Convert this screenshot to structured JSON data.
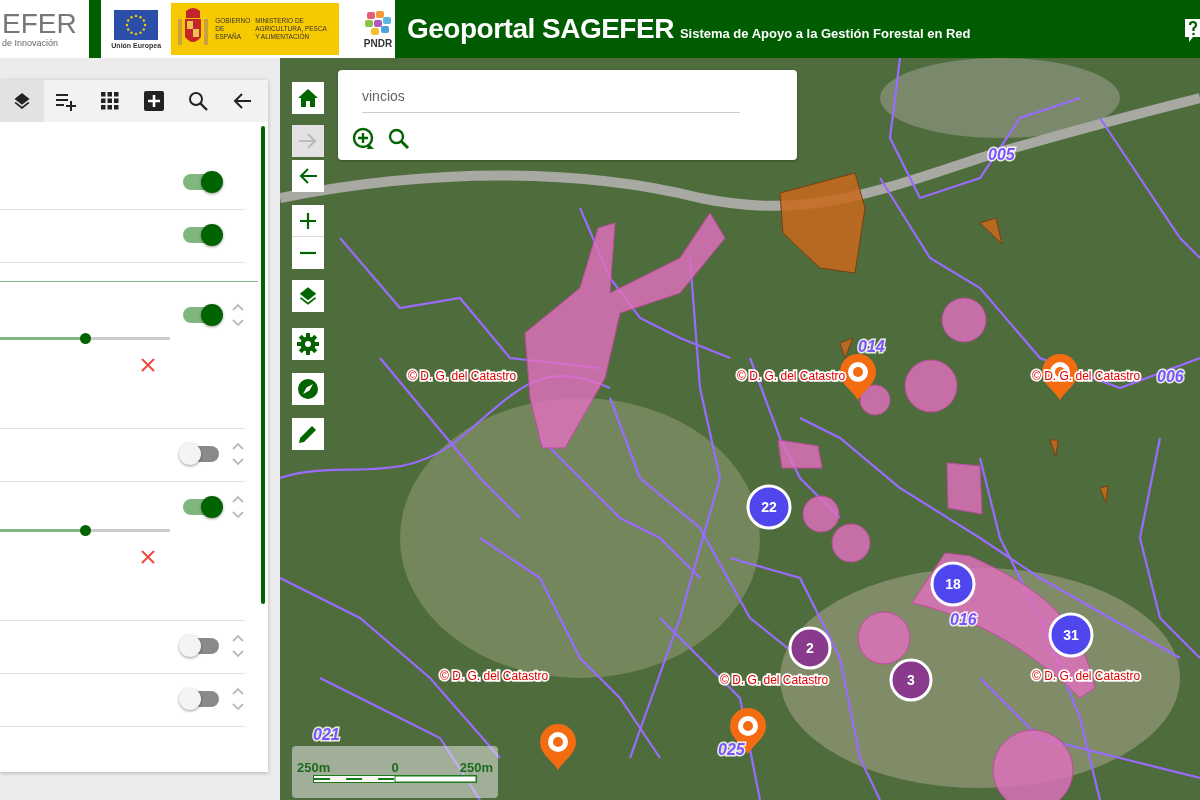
{
  "header": {
    "logo_text": "EFER",
    "logo_subtext": "de Innovación",
    "eu_label": "Unión Europea",
    "gov_label": "GOBIERNO DE ESPAÑA",
    "ministry_label": "MINISTERIO DE AGRICULTURA, PESCA Y ALIMENTACIÓN",
    "pndr_label": "PNDR",
    "title": "Geoportal SAGEFER",
    "subtitle": "Sistema de Apoyo a la Gestión Forestal en Red"
  },
  "panel_tools": [
    {
      "kind": "layers",
      "selected": true
    },
    {
      "kind": "add-list",
      "selected": false
    },
    {
      "kind": "grid",
      "selected": false
    },
    {
      "kind": "plus-box",
      "selected": false
    },
    {
      "kind": "search",
      "selected": false
    },
    {
      "kind": "back",
      "selected": false
    }
  ],
  "layers": [
    {
      "kind": "basic",
      "on": true,
      "order_arrows": false
    },
    {
      "kind": "basic",
      "on": true,
      "order_arrows": false
    },
    {
      "kind": "opacity",
      "on": true,
      "order_arrows": true,
      "level": 0.5
    },
    {
      "kind": "basic",
      "on": false,
      "order_arrows": true
    },
    {
      "kind": "opacity",
      "on": true,
      "order_arrows": true,
      "level": 0.5
    },
    {
      "kind": "basic",
      "on": false,
      "order_arrows": true
    },
    {
      "kind": "basic",
      "on": false,
      "order_arrows": true
    }
  ],
  "map_controls": [
    {
      "kind": "home",
      "disabled": false
    },
    {
      "kind": "forward",
      "disabled": true
    },
    {
      "kind": "back",
      "disabled": false
    },
    {
      "kind": "zoom-in",
      "disabled": false
    },
    {
      "kind": "zoom-out",
      "disabled": false
    },
    {
      "kind": "layers",
      "disabled": false
    },
    {
      "kind": "settings",
      "disabled": false
    },
    {
      "kind": "compass",
      "disabled": false
    },
    {
      "kind": "pencil",
      "disabled": false
    }
  ],
  "search": {
    "value": "vincios"
  },
  "map_labels": [
    {
      "kind": "attribution",
      "text": "© D. G. del Catastro"
    },
    {
      "kind": "attribution",
      "text": "© D. G. del Catastro"
    },
    {
      "kind": "attribution",
      "text": "© D. G. del Catastro"
    },
    {
      "kind": "attribution",
      "text": "© D. G. del Catastro"
    },
    {
      "kind": "attribution",
      "text": "© D. G. del Catastro"
    },
    {
      "kind": "attribution",
      "text": "© D. G. del Catastro"
    },
    {
      "kind": "parcel",
      "text": "005"
    },
    {
      "kind": "parcel",
      "text": "014"
    },
    {
      "kind": "parcel",
      "text": "006"
    },
    {
      "kind": "parcel",
      "text": "016"
    },
    {
      "kind": "parcel",
      "text": "021"
    },
    {
      "kind": "parcel",
      "text": "025"
    }
  ],
  "clusters": [
    {
      "count": "22",
      "color": "#5046ee"
    },
    {
      "count": "18",
      "color": "#5046ee"
    },
    {
      "count": "31",
      "color": "#5046ee"
    },
    {
      "count": "2",
      "color": "#8a3a8c"
    },
    {
      "count": "3",
      "color": "#8a3a8c"
    }
  ],
  "scale": {
    "left": "250m",
    "middle": "0",
    "right": "250m"
  }
}
